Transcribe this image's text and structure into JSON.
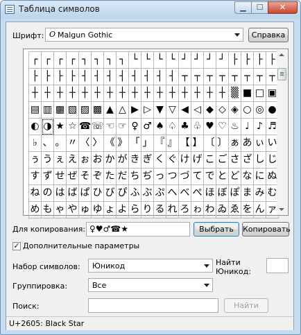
{
  "window": {
    "title": "Таблица символов"
  },
  "font_row": {
    "label": "Шрифт:",
    "font_icon": "O",
    "font_value": "Malgun Gothic",
    "help_label": "Справка"
  },
  "grid": {
    "selected_index": 81,
    "rows": [
      [
        "┌",
        "┌",
        "┌",
        "┌",
        "┐",
        "┐",
        "┐",
        "┐",
        "└",
        "└",
        "└",
        "└",
        "┘",
        "┘",
        "┘",
        "┘",
        "├",
        "├",
        "├",
        "├"
      ],
      [
        "├",
        "├",
        "├",
        "├",
        "┤",
        "┤",
        "┤",
        "┤",
        "┤",
        "┤",
        "┤",
        "┤",
        "┬",
        "┬",
        "┬",
        "┬",
        "┬",
        "┬",
        "┬",
        "┬"
      ],
      [
        "┼",
        "┼",
        "┼",
        "┼",
        "┼",
        "┼",
        "┼",
        "┼",
        "┼",
        "┼",
        "┼",
        "┼",
        "┼",
        "┼",
        "┼",
        "┼",
        "▒",
        "■",
        "□",
        "▣"
      ],
      [
        "▤",
        "▥",
        "▦",
        "▧",
        "▨",
        "▩",
        "▲",
        "△",
        "▶",
        "▷",
        "▼",
        "▽",
        "◀",
        "◁",
        "◆",
        "◇",
        "◈",
        "○",
        "◎",
        "●"
      ],
      [
        "◐",
        "◑",
        "★",
        "☆",
        "☎",
        "☏",
        "☜",
        "☞",
        "♀",
        "♂",
        "♠",
        "♤",
        "♣",
        "♧",
        "♥",
        "♡",
        "♨",
        "♩",
        "♪",
        "♬"
      ],
      [
        "♭",
        "、",
        "。",
        "〃",
        "〈",
        "〉",
        "《",
        "》",
        "「",
        "」",
        "『",
        "』",
        "【",
        "】",
        "〔",
        "〕",
        "ぁ",
        "あ",
        "ぃ",
        "い"
      ],
      [
        "ぅ",
        "う",
        "ぇ",
        "え",
        "ぉ",
        "お",
        "か",
        "が",
        "き",
        "ぎ",
        "く",
        "ぐ",
        "け",
        "げ",
        "こ",
        "ご",
        "さ",
        "ざ",
        "し",
        "じ"
      ],
      [
        "す",
        "ず",
        "せ",
        "ぜ",
        "そ",
        "ぞ",
        "た",
        "だ",
        "ち",
        "ぢ",
        "っ",
        "つ",
        "づ",
        "て",
        "で",
        "と",
        "ど",
        "な",
        "に",
        "ぬ"
      ],
      [
        "ね",
        "の",
        "は",
        "ば",
        "ぱ",
        "ひ",
        "び",
        "ぴ",
        "ふ",
        "ぶ",
        "ぷ",
        "へ",
        "べ",
        "ぺ",
        "ほ",
        "ぼ",
        "ぽ",
        "ま",
        "み",
        "む"
      ],
      [
        "め",
        "も",
        "ゃ",
        "や",
        "ゅ",
        "ゆ",
        "ょ",
        "よ",
        "ら",
        "り",
        "る",
        "れ",
        "ろ",
        "ゎ",
        "わ",
        "ゐ",
        "ゑ",
        "を",
        "ん",
        "ァ"
      ]
    ]
  },
  "copy_row": {
    "label": "Для копирования:",
    "value": "♀♥♂☎★",
    "select_label": "Выбрать",
    "copy_label": "Копировать"
  },
  "advanced": {
    "label": "Дополнительные параметры",
    "checked": true,
    "check_glyph": "✓"
  },
  "charset": {
    "label": "Набор символов:",
    "value": "Юникод"
  },
  "find_unicode": {
    "label_line1": "Найти",
    "label_line2": "Юникод:",
    "value": ""
  },
  "grouping": {
    "label": "Группировка:",
    "value": "Все"
  },
  "search": {
    "label": "Поиск:",
    "value": "",
    "find_label": "Найти"
  },
  "status": {
    "text": "U+2605: Black Star"
  },
  "icons": {
    "minimize": "minimize-icon",
    "maximize": "maximize-icon",
    "close": "close-icon"
  }
}
